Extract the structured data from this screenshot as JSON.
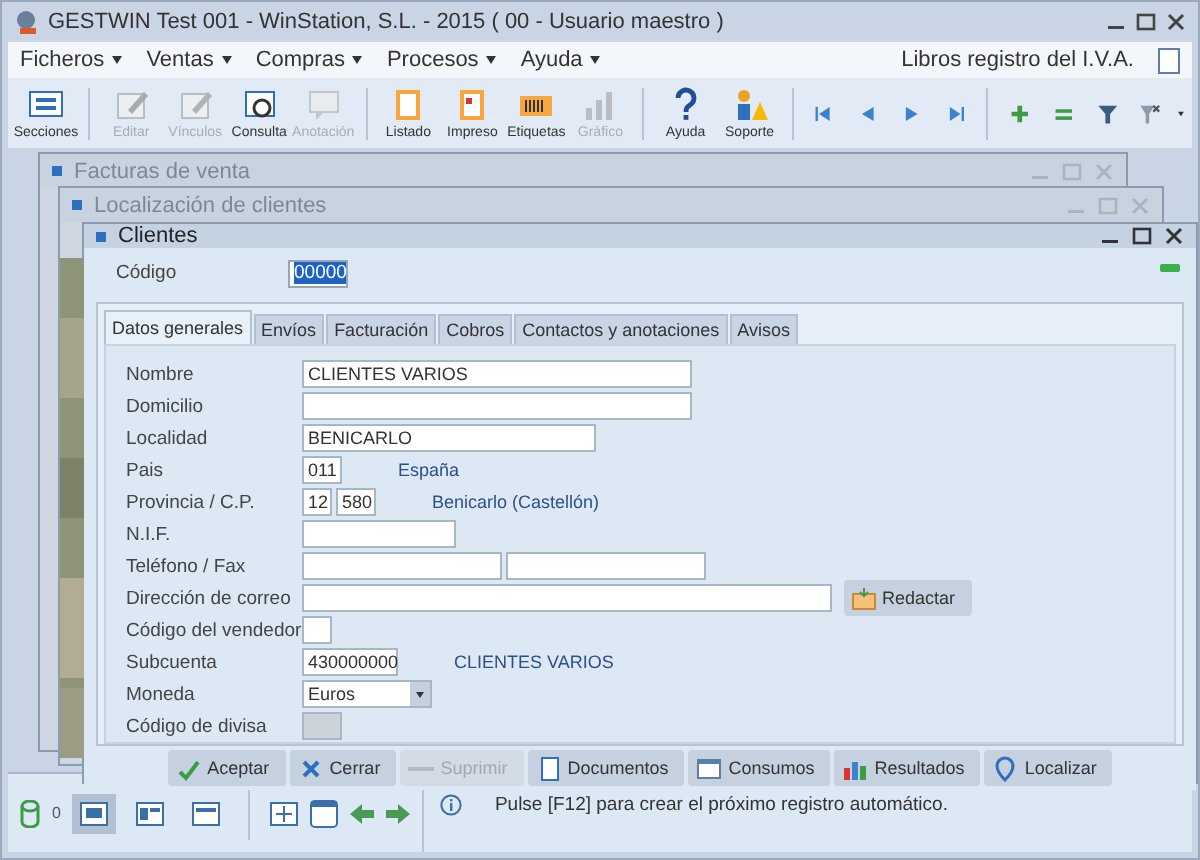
{
  "window": {
    "title": "GESTWIN  Test  001 - WinStation, S.L. - 2015 ( 00 - Usuario maestro )"
  },
  "menu": [
    {
      "label": "Ficheros"
    },
    {
      "label": "Ventas"
    },
    {
      "label": "Compras"
    },
    {
      "label": "Procesos"
    },
    {
      "label": "Ayuda"
    }
  ],
  "shortcut": {
    "label": "Libros registro del I.V.A."
  },
  "toolbar": [
    {
      "label": "Secciones",
      "disabled": false
    },
    {
      "label": "Editar",
      "disabled": true
    },
    {
      "label": "Vínculos",
      "disabled": true
    },
    {
      "label": "Consulta",
      "disabled": false
    },
    {
      "label": "Anotación",
      "disabled": true
    },
    {
      "label": "Listado",
      "disabled": false
    },
    {
      "label": "Impreso",
      "disabled": false
    },
    {
      "label": "Etiquetas",
      "disabled": false
    },
    {
      "label": "Gráfico",
      "disabled": true
    },
    {
      "label": "Ayuda",
      "disabled": false
    },
    {
      "label": "Soporte",
      "disabled": false
    }
  ],
  "background_windows": [
    {
      "title": "Facturas de venta"
    },
    {
      "title": "Localización de clientes"
    }
  ],
  "clientes": {
    "title": "Clientes",
    "code_label": "Código",
    "code_value": "00000",
    "tabs": [
      {
        "label": "Datos generales",
        "selected": true
      },
      {
        "label": "Envíos",
        "selected": false
      },
      {
        "label": "Facturación",
        "selected": false
      },
      {
        "label": "Cobros",
        "selected": false
      },
      {
        "label": "Contactos y anotaciones",
        "selected": false
      },
      {
        "label": "Avisos",
        "selected": false
      }
    ],
    "rows": [
      {
        "label": "Nombre",
        "fields": [
          {
            "kind": "input",
            "value": "CLIENTES VARIOS"
          }
        ]
      },
      {
        "label": "Domicilio",
        "fields": [
          {
            "kind": "input"
          }
        ]
      },
      {
        "label": "Localidad",
        "fields": [
          {
            "kind": "input",
            "value": "BENICARLO"
          }
        ]
      },
      {
        "label": "Pais",
        "fields": [
          {
            "kind": "input",
            "value": "011"
          }
        ],
        "note": "España"
      },
      {
        "label": "Provincia / C.P.",
        "fields": [
          {
            "kind": "input",
            "value": "12"
          },
          {
            "kind": "input",
            "value": "580"
          }
        ],
        "note": "Benicarlo (Castellón)"
      },
      {
        "label": "N.I.F.",
        "fields": [
          {
            "kind": "input"
          }
        ]
      },
      {
        "label": "Teléfono / Fax",
        "fields": [
          {
            "kind": "input"
          },
          {
            "kind": "input"
          }
        ]
      },
      {
        "label": "Dirección de correo",
        "fields": [
          {
            "kind": "input"
          }
        ],
        "button": "Redactar"
      },
      {
        "label": "Código del vendedor",
        "fields": [
          {
            "kind": "input"
          }
        ]
      },
      {
        "label": "Subcuenta",
        "fields": [
          {
            "kind": "input",
            "value": "430000000"
          }
        ],
        "note": "CLIENTES VARIOS"
      },
      {
        "label": "Moneda",
        "fields": [
          {
            "kind": "select",
            "value": "Euros"
          }
        ]
      },
      {
        "label": "Código de divisa",
        "fields": [
          {
            "kind": "locked"
          }
        ]
      }
    ],
    "buttons": [
      {
        "label": "Aceptar",
        "disabled": false
      },
      {
        "label": "Cerrar",
        "disabled": false
      },
      {
        "label": "Suprimir",
        "disabled": true
      },
      {
        "label": "Documentos",
        "disabled": false
      },
      {
        "label": "Consumos",
        "disabled": false
      },
      {
        "label": "Resultados",
        "disabled": false
      },
      {
        "label": "Localizar",
        "disabled": false
      }
    ]
  },
  "status_bar": {
    "count": "0",
    "views": [
      {
        "selected": true
      },
      {
        "selected": false
      },
      {
        "selected": false
      }
    ],
    "message": "Pulse [F12] para crear el próximo registro automático."
  }
}
